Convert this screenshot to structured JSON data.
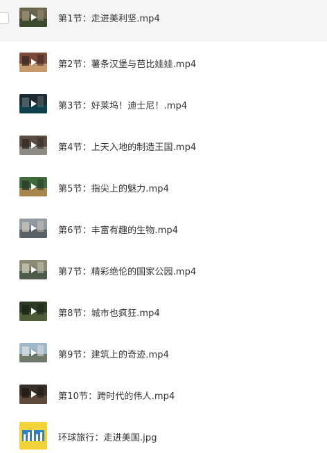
{
  "files": [
    {
      "name": "第1节：走进美利坚.mp4",
      "type": "video",
      "thumb_colors": [
        "#6b6550",
        "#3d4a2d",
        "#9a8e72"
      ]
    },
    {
      "name": "第2节：薯条汉堡与芭比娃娃.mp4",
      "type": "video",
      "thumb_colors": [
        "#7a4b3a",
        "#c49a6c",
        "#3a2a22"
      ]
    },
    {
      "name": "第3节：好莱坞！迪士尼！.mp4",
      "type": "video",
      "thumb_colors": [
        "#1d2a33",
        "#0e3f4a",
        "#5a6a70"
      ]
    },
    {
      "name": "第4节：上天入地的制造王国.mp4",
      "type": "video",
      "thumb_colors": [
        "#5b4c3f",
        "#8d8a84",
        "#2f2a26"
      ]
    },
    {
      "name": "第5节：指尖上的魅力.mp4",
      "type": "video",
      "thumb_colors": [
        "#3f6a3a",
        "#a8864f",
        "#2c3a2a"
      ]
    },
    {
      "name": "第6节：丰富有趣的生物.mp4",
      "type": "video",
      "thumb_colors": [
        "#8e9aa0",
        "#5b6268",
        "#c9c3b8"
      ]
    },
    {
      "name": "第7节：精彩绝伦的国家公园.mp4",
      "type": "video",
      "thumb_colors": [
        "#8c8a76",
        "#4e5a4a",
        "#c8c4b2"
      ]
    },
    {
      "name": "第8节：城市也疯狂.mp4",
      "type": "video",
      "thumb_colors": [
        "#2e3a24",
        "#4f5e3a",
        "#1c2416"
      ]
    },
    {
      "name": "第9节：建筑上的奇迹.mp4",
      "type": "video",
      "thumb_colors": [
        "#9fb7c9",
        "#6f7a6a",
        "#d8dde0"
      ]
    },
    {
      "name": "第10节：跨时代的伟人.mp4",
      "type": "video",
      "thumb_colors": [
        "#3a2e28",
        "#5e4a3c",
        "#1f1915"
      ]
    },
    {
      "name": "环球旅行：走进美国.jpg",
      "type": "image",
      "thumb_colors": [
        "#f2d23a",
        "#2e7fc2",
        "#ffffff"
      ]
    }
  ],
  "selected_index": 0
}
